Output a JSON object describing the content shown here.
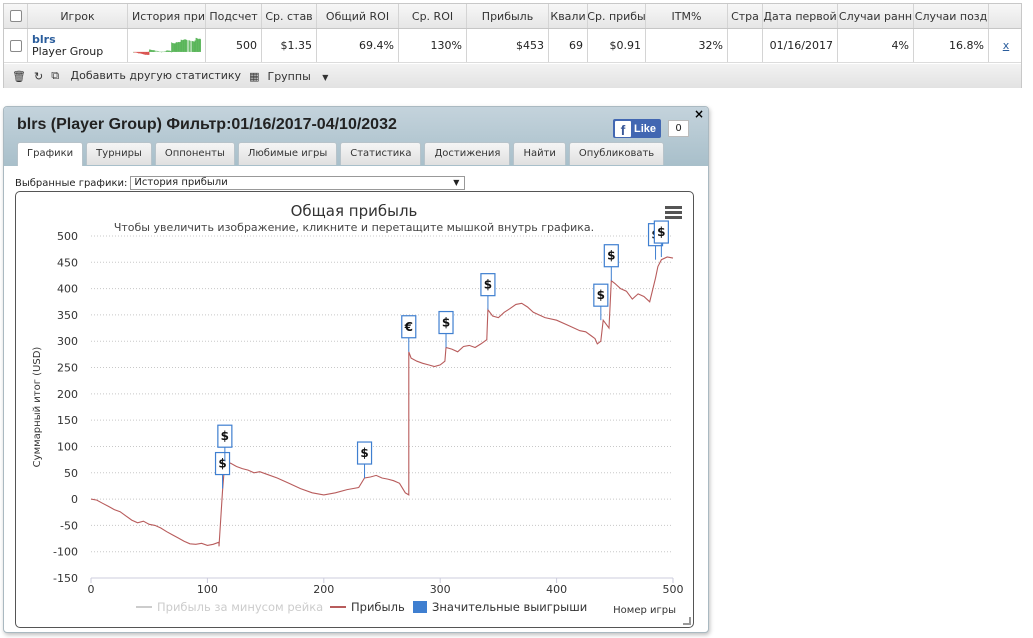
{
  "grid": {
    "headers": [
      "",
      "Игрок",
      "История при",
      "Подсчет",
      "Ср. став",
      "Общий ROI",
      "Ср. ROI",
      "Прибыль",
      "Квали",
      "Ср. прибы",
      "ITM%",
      "Стра",
      "Дата первой",
      "Случаи ранн",
      "Случаи позд",
      ""
    ],
    "player_name": "blrs",
    "player_group": "Player Group",
    "cells": [
      "500",
      "$1.35",
      "69.4%",
      "130%",
      "$453",
      "69",
      "$0.91",
      "32%",
      "",
      "01/16/2017",
      "4%",
      "16.8%"
    ],
    "remove_link": "x",
    "toolbar": {
      "add_stat": "Добавить другую статистику",
      "groups": "Группы"
    }
  },
  "panel": {
    "title": "blrs (Player Group) Фильтр:01/16/2017-04/10/2032",
    "like_label": "Like",
    "like_count": "0",
    "close": "×",
    "tabs": [
      "Графики",
      "Турниры",
      "Оппоненты",
      "Любимые игры",
      "Статистика",
      "Достижения",
      "Найти",
      "Опубликовать"
    ],
    "graph_select_label": "Выбранные графики:",
    "graph_select_value": "История прибыли"
  },
  "colors": {
    "profit": "#b85c5c",
    "significant": "#3f7fd0",
    "rake": "#cccccc",
    "header_bg": "#b4c7d0"
  },
  "chart_data": {
    "type": "line",
    "title": "Общая прибыль",
    "subtitle": "Чтобы увеличить изображение, кликните и перетащите мышкой внутрь графика.",
    "ylabel": "Суммарный итог (USD)",
    "xlabel": "Номер игры",
    "xlim": [
      0,
      500
    ],
    "ylim": [
      -150,
      500
    ],
    "xticks": [
      0,
      100,
      200,
      300,
      400,
      500
    ],
    "yticks": [
      -150,
      -100,
      -50,
      0,
      50,
      100,
      150,
      200,
      250,
      300,
      350,
      400,
      450,
      500
    ],
    "grid": true,
    "legend_position": "bottom",
    "series": [
      {
        "name": "Прибыль за минусом рейка",
        "values": []
      },
      {
        "name": "Прибыль",
        "x": [
          0,
          5,
          10,
          15,
          20,
          25,
          30,
          35,
          40,
          45,
          50,
          55,
          60,
          65,
          70,
          75,
          80,
          85,
          90,
          95,
          100,
          105,
          110,
          110,
          113,
          115,
          120,
          125,
          130,
          135,
          140,
          145,
          150,
          160,
          170,
          180,
          190,
          200,
          210,
          220,
          230,
          235,
          240,
          245,
          250,
          255,
          260,
          265,
          270,
          273,
          273,
          275,
          280,
          285,
          290,
          295,
          300,
          304,
          305,
          310,
          315,
          320,
          325,
          330,
          335,
          340,
          341,
          345,
          350,
          355,
          360,
          365,
          370,
          375,
          380,
          390,
          400,
          410,
          420,
          425,
          430,
          433,
          435,
          438,
          440,
          445,
          447,
          450,
          455,
          460,
          465,
          470,
          475,
          480,
          485,
          487,
          490,
          495,
          500
        ],
        "y": [
          0,
          -2,
          -8,
          -14,
          -20,
          -24,
          -32,
          -40,
          -45,
          -42,
          -48,
          -50,
          -55,
          -62,
          -68,
          -74,
          -80,
          -85,
          -86,
          -84,
          -88,
          -86,
          -82,
          -90,
          15,
          72,
          68,
          62,
          58,
          55,
          50,
          52,
          48,
          40,
          30,
          20,
          12,
          8,
          12,
          18,
          22,
          40,
          42,
          45,
          40,
          38,
          35,
          30,
          12,
          8,
          280,
          268,
          262,
          258,
          255,
          252,
          255,
          262,
          288,
          285,
          280,
          290,
          292,
          288,
          295,
          303,
          360,
          348,
          345,
          355,
          362,
          370,
          372,
          365,
          355,
          345,
          340,
          330,
          320,
          318,
          310,
          305,
          295,
          300,
          340,
          325,
          415,
          410,
          400,
          395,
          380,
          390,
          385,
          375,
          420,
          442,
          455,
          460,
          458
        ]
      },
      {
        "name": "Значительные выигрыши",
        "markers": [
          {
            "x": 113,
            "y": 20,
            "label": "$"
          },
          {
            "x": 115,
            "y": 72,
            "label": "$"
          },
          {
            "x": 235,
            "y": 40,
            "label": "$"
          },
          {
            "x": 273,
            "y": 280,
            "label": "€"
          },
          {
            "x": 305,
            "y": 288,
            "label": "$"
          },
          {
            "x": 341,
            "y": 360,
            "label": "$"
          },
          {
            "x": 438,
            "y": 340,
            "label": "$"
          },
          {
            "x": 447,
            "y": 415,
            "label": "$"
          },
          {
            "x": 485,
            "y": 455,
            "label": "$"
          },
          {
            "x": 490,
            "y": 460,
            "label": "$"
          }
        ]
      }
    ]
  }
}
